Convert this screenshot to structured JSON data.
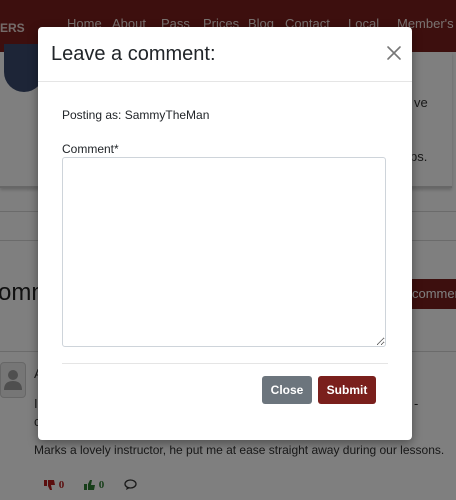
{
  "navbar": {
    "brand": "ERS",
    "links": [
      "Home",
      "About",
      "Pass",
      "Prices",
      "Blog",
      "Contact",
      "Local",
      "Member's"
    ]
  },
  "background": {
    "fragment_ve": "ve",
    "fragment_ps": "ps.",
    "section_title": "omm",
    "add_comment_label": "comment",
    "reviewer_initial": "A",
    "fragment_i": "I",
    "fragment_c": "c",
    "fragment_dash": "-",
    "review_text": "Marks a lovely instructor, he put me at ease straight away during our lessons.",
    "dislikes": "0",
    "likes": "0"
  },
  "modal": {
    "title": "Leave a comment:",
    "posting_as": "Posting as: SammyTheMan",
    "comment_label": "Comment*",
    "comment_value": "",
    "close_button": "Close",
    "submit_button": "Submit"
  },
  "colors": {
    "brand": "#7a1f1c",
    "secondary": "#6c757d",
    "like": "#2e7d32",
    "dislike": "#b71c1c"
  },
  "icons": [
    "close-icon",
    "user-icon",
    "thumbs-down-icon",
    "thumbs-up-icon",
    "comment-bubble-icon"
  ]
}
